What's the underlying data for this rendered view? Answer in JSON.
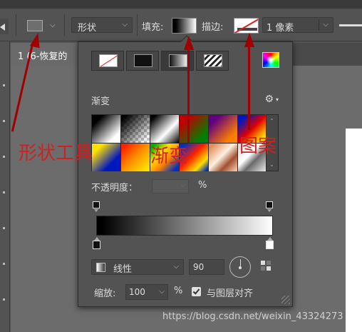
{
  "options_bar": {
    "mode_label": "形状",
    "fill_label": "填充:",
    "stroke_label": "描边:",
    "stroke_width": "1 像素"
  },
  "document": {
    "tab_title": "1 (6-恢复的"
  },
  "fill_panel": {
    "fill_types": [
      "none",
      "solid",
      "gradient",
      "pattern"
    ],
    "active_type": "gradient",
    "section_title": "渐变",
    "presets": [
      {
        "name": "black-white"
      },
      {
        "name": "black-transparent"
      },
      {
        "name": "black-white-black"
      },
      {
        "name": "red-green"
      },
      {
        "name": "violet-orange"
      },
      {
        "name": "blue-red-yellow"
      },
      {
        "name": "yellow-blue"
      },
      {
        "name": "red-yellow"
      },
      {
        "name": "green-yellow-orange-blue"
      },
      {
        "name": "spectrum"
      },
      {
        "name": "copper"
      },
      {
        "name": "chrome"
      }
    ],
    "opacity_label": "不透明度：",
    "opacity_unit": "%",
    "gradient_style": "线性",
    "angle": "90",
    "scale_label": "缩放:",
    "scale_value": "100",
    "scale_unit": "%",
    "align_label": "与图层对齐",
    "align_checked": true
  },
  "annotations": {
    "shape_tool": "形状工具",
    "gradient": "渐变",
    "pattern": "图案",
    "color": "#d02020"
  },
  "watermark": "https://blog.csdn.net/weixin_43324273"
}
